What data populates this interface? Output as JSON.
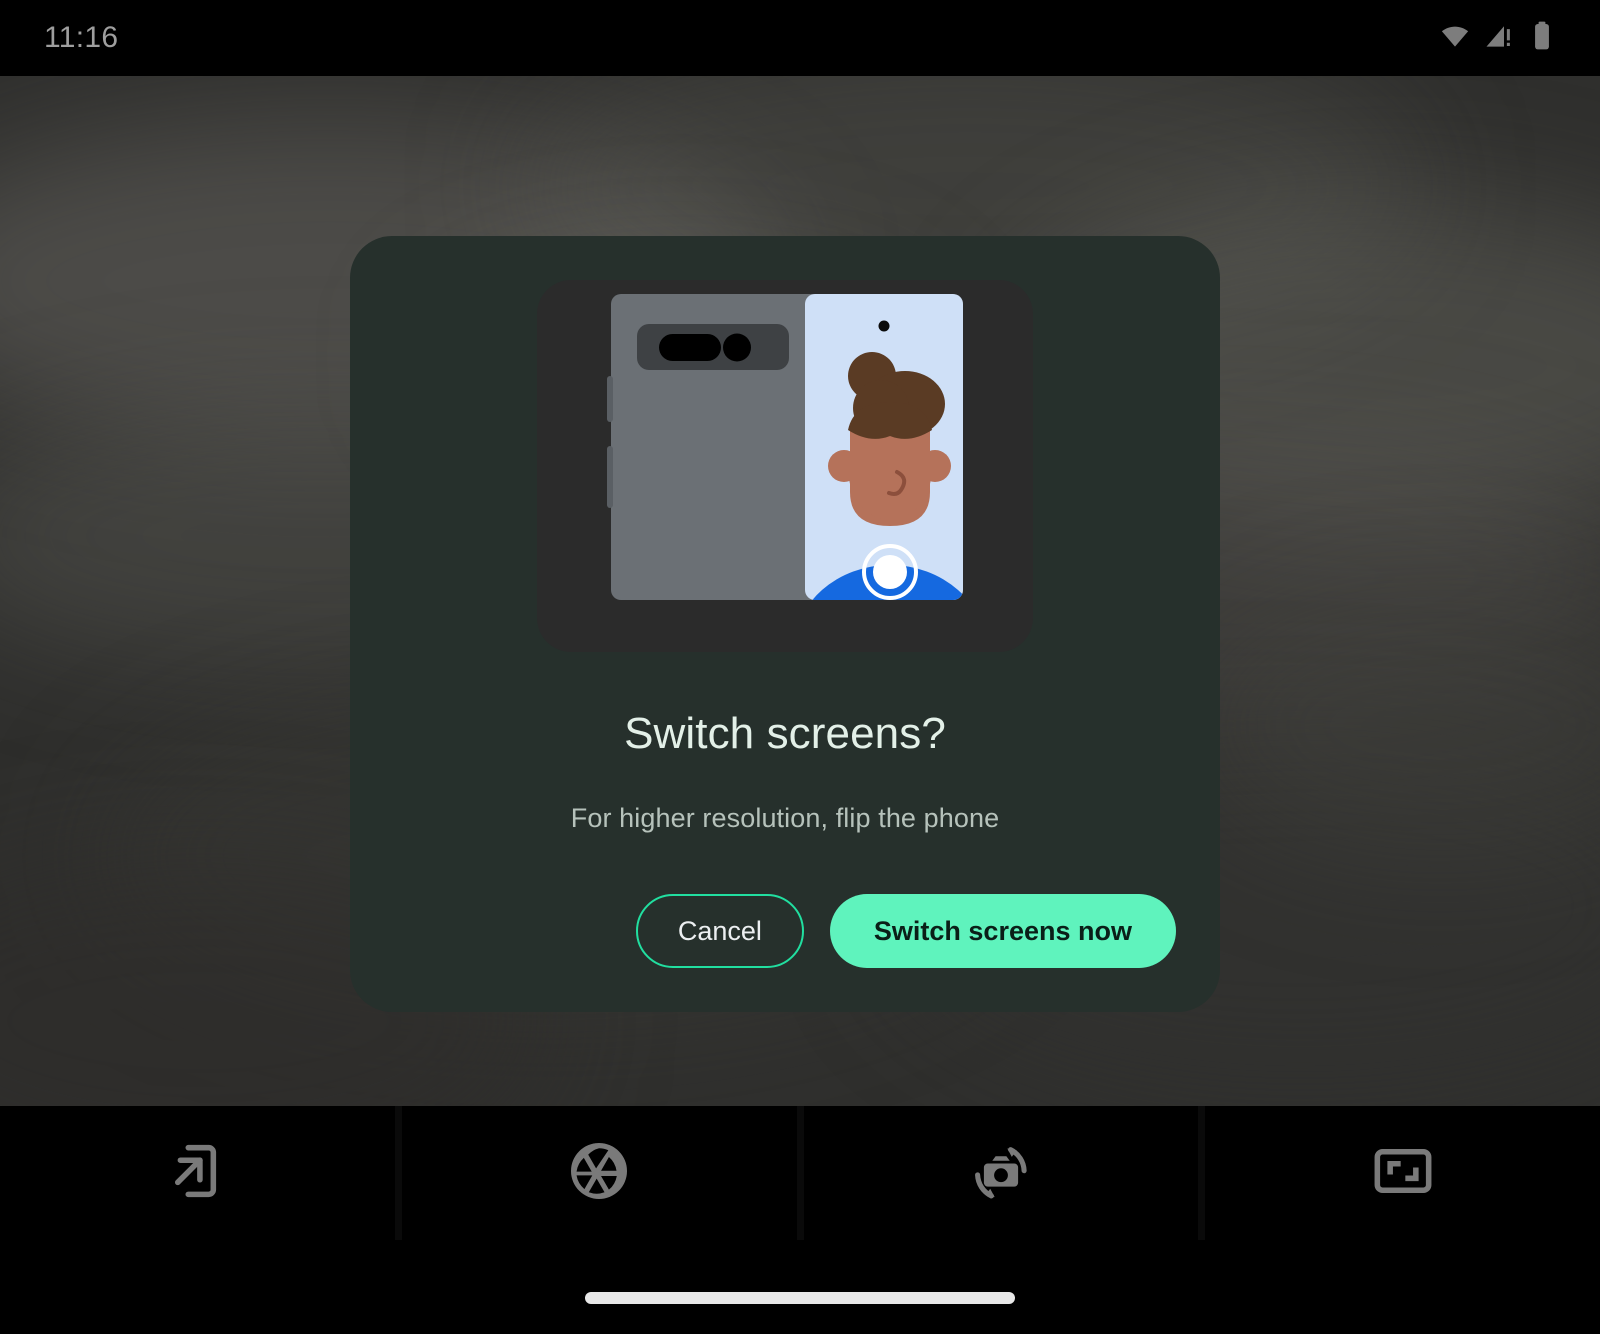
{
  "status_bar": {
    "time": "11:16",
    "icons": [
      {
        "name": "wifi-icon",
        "label": "wifi"
      },
      {
        "name": "cellular-signal-warning-icon",
        "label": "mobile-signal-no-service"
      },
      {
        "name": "battery-icon",
        "label": "battery-full"
      }
    ],
    "text_color": "#9e9e9e"
  },
  "dialog": {
    "title": "Switch screens?",
    "subtitle": "For higher resolution, flip the phone",
    "background_color": "#26302C",
    "title_color": "#E3F0E8",
    "subtitle_color": "#B6C2BB",
    "illustration": {
      "name": "foldable-phone-flip-illustration",
      "body_color": "#6B7075",
      "frame_color": "#2B2B2B",
      "camera_bar_color": "#3E4144",
      "screen_color": "#CFE0F7",
      "shirt_color": "#1569E0",
      "skin_color": "#B5725A",
      "hair_color": "#5A3B24",
      "shutter_color": "#FFFFFF"
    },
    "buttons": {
      "cancel": {
        "label": "Cancel",
        "style": "outlined",
        "border_color": "#21DFA0",
        "text_color": "#ECEFF1"
      },
      "confirm": {
        "label": "Switch screens now",
        "style": "filled",
        "fill_color": "#5FF3BD",
        "text_color": "#0A1F18"
      }
    }
  },
  "toolbar": {
    "items": [
      {
        "name": "switch-to-cover-screen-icon",
        "label": "Switch screen"
      },
      {
        "name": "camera-aperture-icon",
        "label": "Shutter settings"
      },
      {
        "name": "flip-camera-icon",
        "label": "Flip camera"
      },
      {
        "name": "aspect-ratio-icon",
        "label": "Aspect ratio"
      }
    ],
    "icon_color": "#7A7A7A",
    "background_color": "#000000"
  },
  "nav_bar": {
    "home_indicator": "home-indicator",
    "color": "#E8E8E8"
  },
  "viewfinder": {
    "name": "camera-viewfinder-preview",
    "description": "blurred dark camera preview",
    "base_color": "#2F2F2D"
  }
}
